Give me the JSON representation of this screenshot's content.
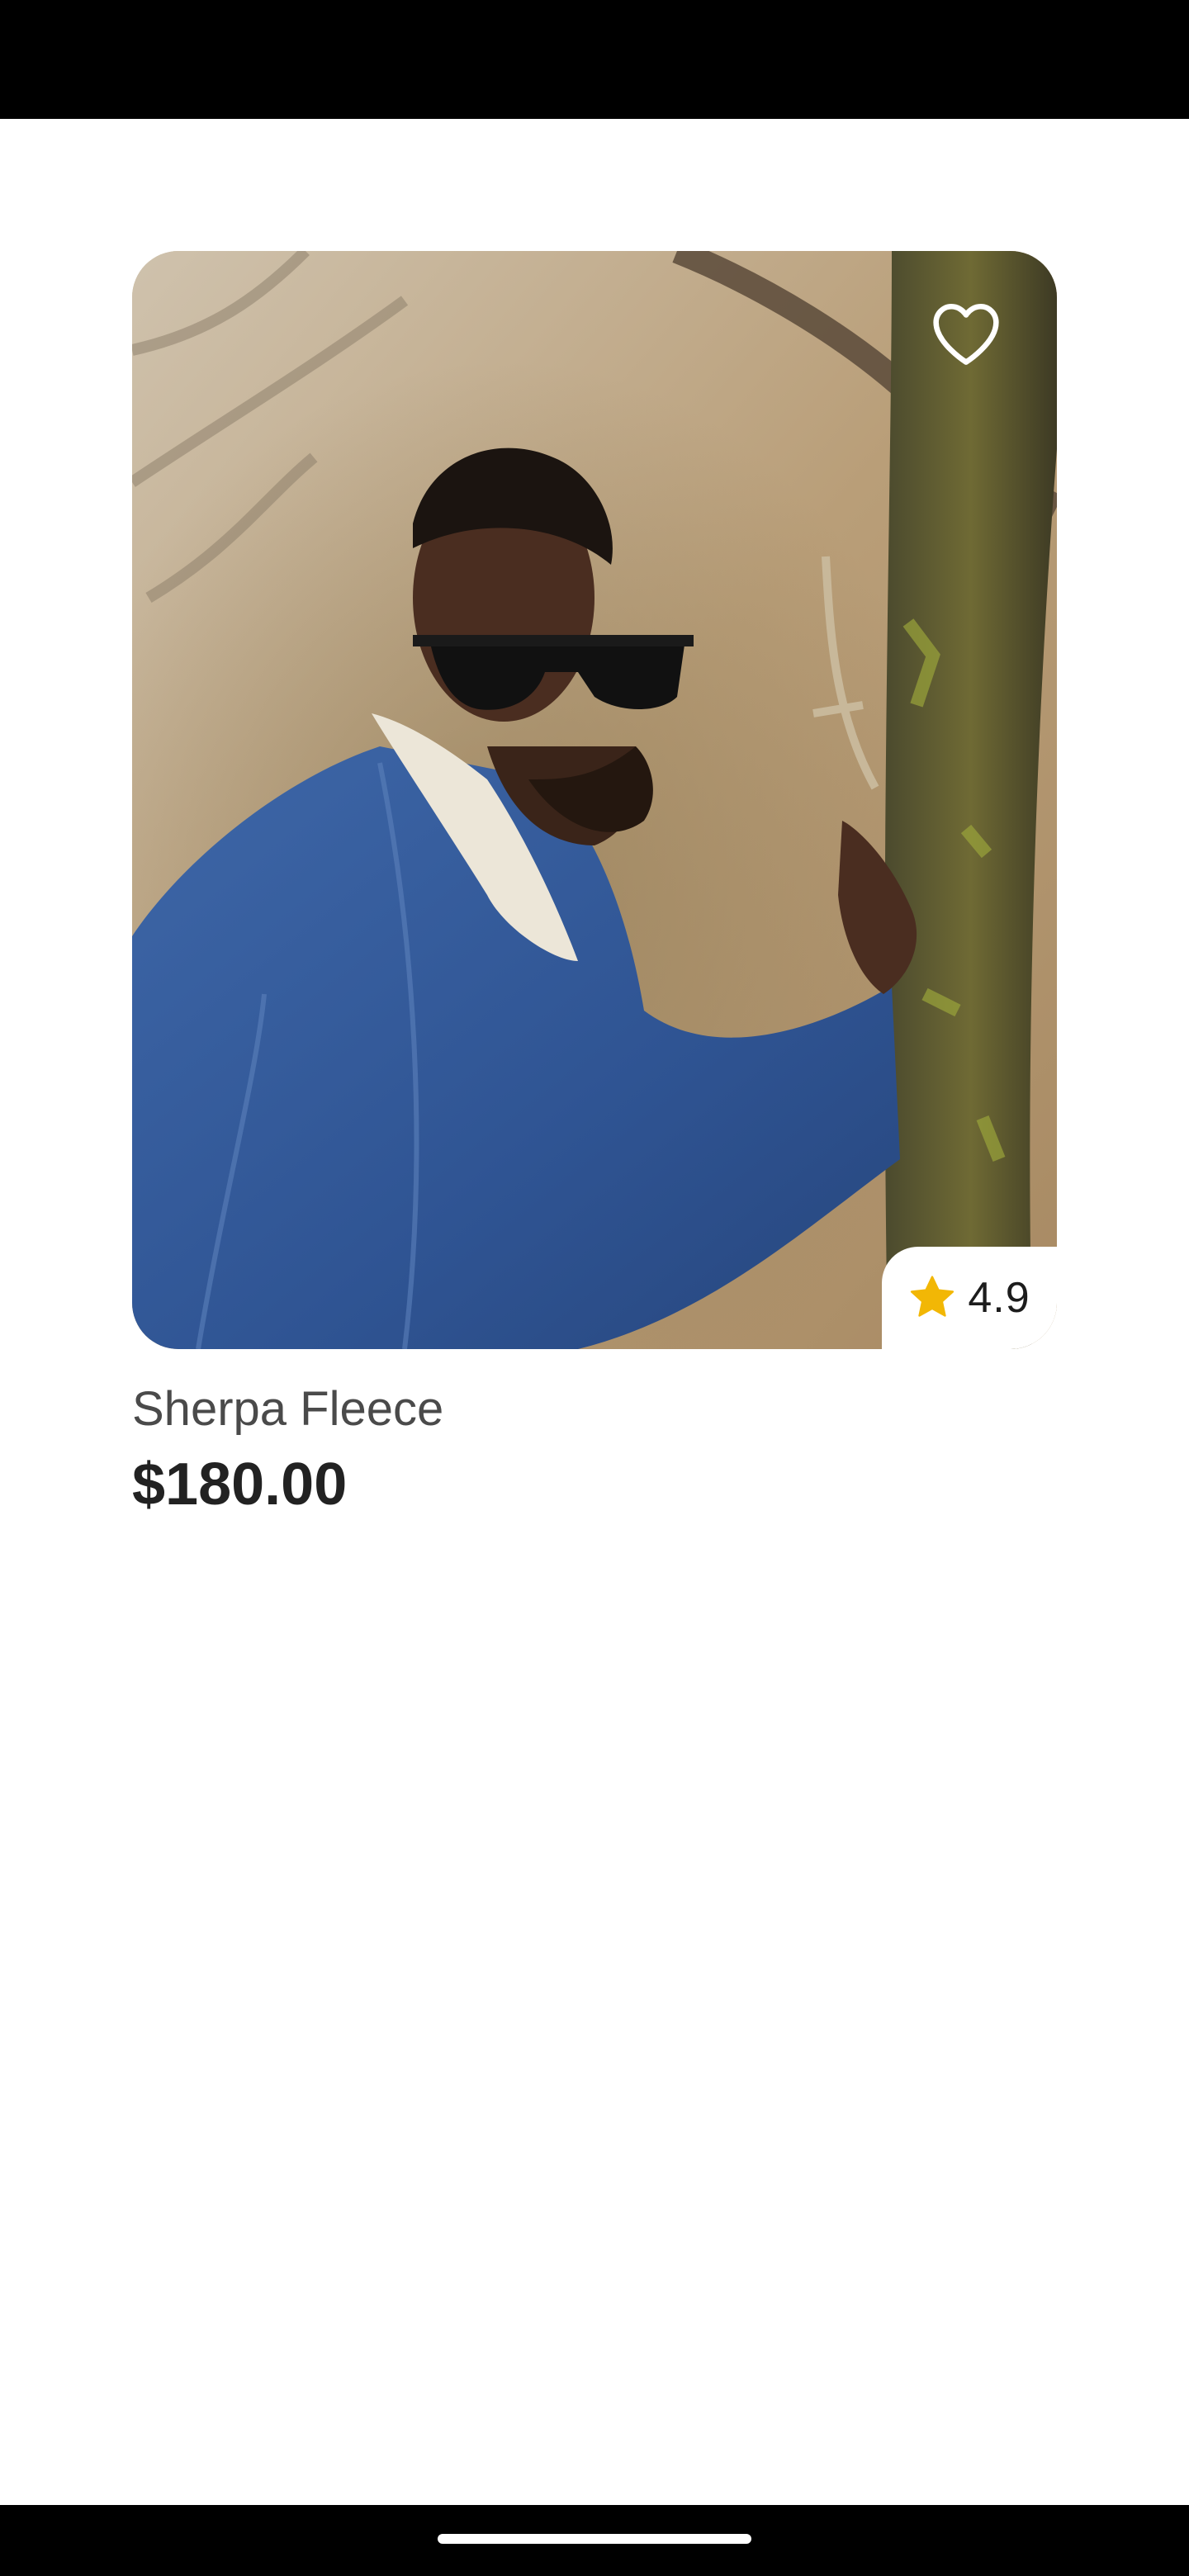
{
  "product": {
    "name": "Sherpa Fleece",
    "price": "$180.00",
    "rating": "4.9",
    "image_description": "Man in a denim jacket with a sherpa collar and sunglasses, leaning against a tree",
    "favorite_icon": "heart-outline-icon",
    "rating_icon": "star-icon"
  },
  "colors": {
    "star": "#F2B705",
    "price_text": "#222222",
    "name_text": "#4A4A4A",
    "system_bars": "#000000",
    "background": "#FFFFFF"
  }
}
